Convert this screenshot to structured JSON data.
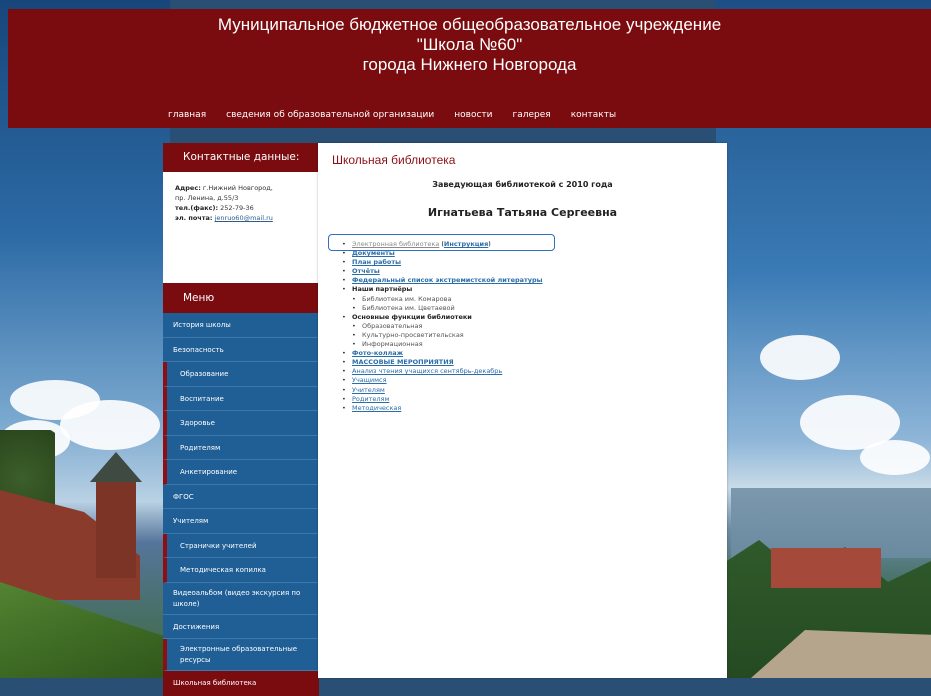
{
  "header": {
    "title_line1": "Муниципальное бюджетное общеобразовательное учреждение",
    "title_line2": "\"Школа №60\"",
    "title_line3": "города Нижнего Новгорода"
  },
  "nav": [
    {
      "label": "главная"
    },
    {
      "label": "сведения об образовательной организации"
    },
    {
      "label": "новости"
    },
    {
      "label": "галерея"
    },
    {
      "label": "контакты"
    }
  ],
  "sidebar": {
    "contacts_title": "Контактные данные:",
    "address_label": "Адрес:",
    "address_value": "г.Нижний Новгород,",
    "address_value2": "пр. Ленина, д.55/3",
    "phone_label": "тел.(факс):",
    "phone_value": "252-79-36",
    "email_label": "эл. почта:",
    "email_value": "jenruo60@mail.ru",
    "menu_title": "Меню",
    "menu": [
      {
        "label": "История школы"
      },
      {
        "label": "Безопасность"
      },
      {
        "label": "Образование"
      },
      {
        "label": "Воспитание"
      },
      {
        "label": "Здоровье"
      },
      {
        "label": "Родителям"
      },
      {
        "label": "Анкетирование"
      },
      {
        "label": "ФГОС"
      },
      {
        "label": "Учителям"
      },
      {
        "label": "Странички учителей"
      },
      {
        "label": "Методическая копилка"
      },
      {
        "label": "Видеоальбом (видео экскурсия по школе)"
      },
      {
        "label": "Достижения"
      },
      {
        "label": "Электронные образовательные ресурсы"
      },
      {
        "label": "Школьная библиотека"
      }
    ]
  },
  "content": {
    "title": "Школьная библиотека",
    "subtitle": "Заведующая библиотекой с 2010 года",
    "name": "Игнатьева Татьяна Сергеевна",
    "links": {
      "e_library": "Электронная библиотека",
      "instruction": "Инструкция",
      "documents": "Документы",
      "plan": "План работы",
      "reports": "Отчёты",
      "extremist_list": "Федеральный список экстремистской литературы",
      "partners": "Наши партнёры",
      "partner1": "Библиотека им. Комарова",
      "partner2": "Библиотека им. Цветаевой",
      "functions": "Основные функции библиотеки",
      "func1": "Образовательная",
      "func2": "Культурно-просветительская",
      "func3": "Информационная",
      "photo": "Фото-коллаж",
      "events": "МАССОВЫЕ МЕРОПРИЯТИЯ",
      "analysis": "Анализ чтения учащихся сентябрь-декабрь",
      "students": "Учащимся",
      "teachers": "Учителям",
      "parents": "Родителям",
      "methodical": "Методическая"
    }
  }
}
